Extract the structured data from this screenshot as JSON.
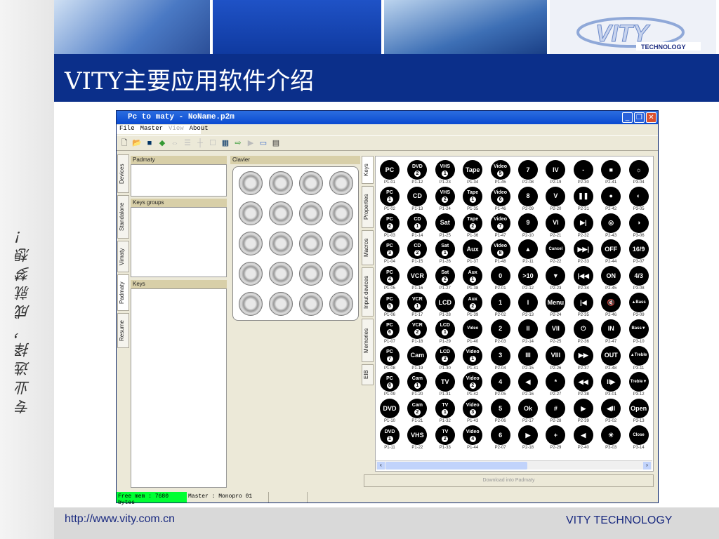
{
  "slide": {
    "title": "VITY主要应用软件介绍",
    "slogan": "专业选择，成就梦想！",
    "url": "http://www.vity.com.cn",
    "brand": "VITY TECHNOLOGY",
    "logo": "VITY TECHNOLOGY"
  },
  "window": {
    "title": "Pc to maty - NoName.p2m",
    "menu": [
      "File",
      "Master",
      "View",
      "About"
    ],
    "left_tabs": [
      "Devices",
      "Standalone",
      "Vimaty",
      "Padmaty",
      "Resume"
    ],
    "panels": {
      "padmaty": "Padmaty",
      "keys_groups": "Keys groups",
      "keys": "Keys",
      "clavier": "Clavier"
    },
    "right_tabs": [
      "Keys",
      "Properties",
      "Macros",
      "Input devices",
      "Memories",
      "EIB"
    ],
    "download": "Download into Padmaty",
    "status": {
      "free_mem": "Free mem : 7680 bytes",
      "master": "Master : Monopro 01"
    }
  },
  "keys": [
    [
      [
        "PC",
        "",
        "P1-01"
      ],
      [
        "PC",
        "1",
        "P1-02"
      ],
      [
        "PC",
        "2",
        "P1-03"
      ],
      [
        "PC",
        "3",
        "P1-04"
      ],
      [
        "PC",
        "4",
        "P1-05"
      ],
      [
        "PC",
        "5",
        "P1-06"
      ],
      [
        "PC",
        "6",
        "P1-07"
      ],
      [
        "PC",
        "7",
        "P1-08"
      ],
      [
        "PC",
        "8",
        "P1-09"
      ],
      [
        "DVD",
        "",
        "P1-10"
      ],
      [
        "DVD",
        "1",
        "P1-11"
      ]
    ],
    [
      [
        "DVD",
        "2",
        "P1-12"
      ],
      [
        "CD",
        "",
        "P1-13"
      ],
      [
        "CD",
        "1",
        "P1-14"
      ],
      [
        "CD",
        "2",
        "P1-15"
      ],
      [
        "VCR",
        "",
        "P1-16"
      ],
      [
        "VCR",
        "1",
        "P1-17"
      ],
      [
        "VCR",
        "2",
        "P1-18"
      ],
      [
        "Cam",
        "",
        "P1-19"
      ],
      [
        "Cam",
        "1",
        "P1-20"
      ],
      [
        "Cam",
        "2",
        "P1-21"
      ],
      [
        "VHS",
        "",
        "P1-22"
      ]
    ],
    [
      [
        "VHS",
        "1",
        "P1-23"
      ],
      [
        "VHS",
        "2",
        "P1-24"
      ],
      [
        "Sat",
        "",
        "P1-25"
      ],
      [
        "Sat",
        "1",
        "P1-26"
      ],
      [
        "Sat",
        "2",
        "P1-27"
      ],
      [
        "LCD",
        "",
        "P1-28"
      ],
      [
        "LCD",
        "1",
        "P1-29"
      ],
      [
        "LCD",
        "2",
        "P1-30"
      ],
      [
        "TV",
        "",
        "P1-31"
      ],
      [
        "TV",
        "1",
        "P1-32"
      ],
      [
        "TV",
        "2",
        "P1-33"
      ]
    ],
    [
      [
        "Tape",
        "",
        "P1-34"
      ],
      [
        "Tape",
        "1",
        "P1-35"
      ],
      [
        "Tape",
        "2",
        "P1-36"
      ],
      [
        "Aux",
        "",
        "P1-37"
      ],
      [
        "Aux",
        "1",
        "P1-38"
      ],
      [
        "Aux",
        "2",
        "P1-39"
      ],
      [
        "Video",
        "",
        "P1-40"
      ],
      [
        "Video",
        "1",
        "P1-41"
      ],
      [
        "Video",
        "2",
        "P1-42"
      ],
      [
        "Video",
        "3",
        "P1-43"
      ],
      [
        "Video",
        "4",
        "P1-44"
      ]
    ],
    [
      [
        "Video",
        "5",
        "P1-45"
      ],
      [
        "Video",
        "6",
        "P1-46"
      ],
      [
        "Video",
        "7",
        "P1-47"
      ],
      [
        "Video",
        "8",
        "P1-48"
      ],
      [
        "0",
        "",
        "P2-01"
      ],
      [
        "1",
        "",
        "P2-02"
      ],
      [
        "2",
        "",
        "P2-03"
      ],
      [
        "3",
        "",
        "P2-04"
      ],
      [
        "4",
        "",
        "P2-05"
      ],
      [
        "5",
        "",
        "P2-06"
      ],
      [
        "6",
        "",
        "P2-07"
      ]
    ],
    [
      [
        "7",
        "",
        "P2-08"
      ],
      [
        "8",
        "",
        "P2-09"
      ],
      [
        "9",
        "",
        "P2-10"
      ],
      [
        "▲",
        "",
        "P2-11"
      ],
      [
        ">10",
        "",
        "P2-12"
      ],
      [
        "I",
        "",
        "P2-13"
      ],
      [
        "II",
        "",
        "P2-14"
      ],
      [
        "III",
        "",
        "P2-15"
      ],
      [
        "◀",
        "",
        "P2-16"
      ],
      [
        "Ok",
        "",
        "P2-17"
      ],
      [
        "▶",
        "",
        "P2-18"
      ]
    ],
    [
      [
        "IV",
        "",
        "P2-19"
      ],
      [
        "V",
        "",
        "P2-20"
      ],
      [
        "VI",
        "",
        "P2-21"
      ],
      [
        "Cancel",
        "",
        "P2-22"
      ],
      [
        "▼",
        "",
        "P2-23"
      ],
      [
        "Menu",
        "",
        "P2-24"
      ],
      [
        "VII",
        "",
        "P2-25"
      ],
      [
        "VIII",
        "",
        "P2-26"
      ],
      [
        "*",
        "",
        "P2-27"
      ],
      [
        "#",
        "",
        "P2-28"
      ],
      [
        "+",
        "",
        "P2-29"
      ]
    ],
    [
      [
        "-",
        "",
        "P2-30"
      ],
      [
        "❚❚",
        "",
        "P2-31"
      ],
      [
        "▶|",
        "",
        "P2-32"
      ],
      [
        "▶▶|",
        "",
        "P2-33"
      ],
      [
        "|◀◀",
        "",
        "P2-34"
      ],
      [
        "|◀",
        "",
        "P2-35"
      ],
      [
        "⏻",
        "",
        "P2-36"
      ],
      [
        "▶▶",
        "",
        "P2-37"
      ],
      [
        "◀◀",
        "",
        "P2-38"
      ],
      [
        "▶",
        "",
        "P2-39"
      ],
      [
        "◀",
        "",
        "P2-40"
      ]
    ],
    [
      [
        "■",
        "",
        "P2-41"
      ],
      [
        "●",
        "",
        "P2-42"
      ],
      [
        "◎",
        "",
        "P2-43"
      ],
      [
        "OFF",
        "",
        "P2-44"
      ],
      [
        "ON",
        "",
        "P2-45"
      ],
      [
        "🔇",
        "",
        "P2-46"
      ],
      [
        "IN",
        "",
        "P2-47"
      ],
      [
        "OUT",
        "",
        "P2-48"
      ],
      [
        "II▶",
        "",
        "P3-01"
      ],
      [
        "◀II",
        "",
        "P3-02"
      ],
      [
        "☀",
        "",
        "P3-03"
      ]
    ],
    [
      [
        "☼",
        "",
        "P3-04"
      ],
      [
        "◐",
        "",
        "P3-05"
      ],
      [
        "◑",
        "",
        "P3-06"
      ],
      [
        "16/9",
        "",
        "P3-07"
      ],
      [
        "4/3",
        "",
        "P3-08"
      ],
      [
        "▲Bass",
        "",
        "P3-09"
      ],
      [
        "Bass▼",
        "",
        "P3-10"
      ],
      [
        "▲Treble",
        "",
        "P3-11"
      ],
      [
        "Treble▼",
        "",
        "P3-12"
      ],
      [
        "Open",
        "",
        "P3-13"
      ],
      [
        "Close",
        "",
        "P3-14"
      ]
    ]
  ],
  "colors": {
    "title_bar": "#0b2f8a",
    "free_mem_bg": "#00ff33"
  }
}
